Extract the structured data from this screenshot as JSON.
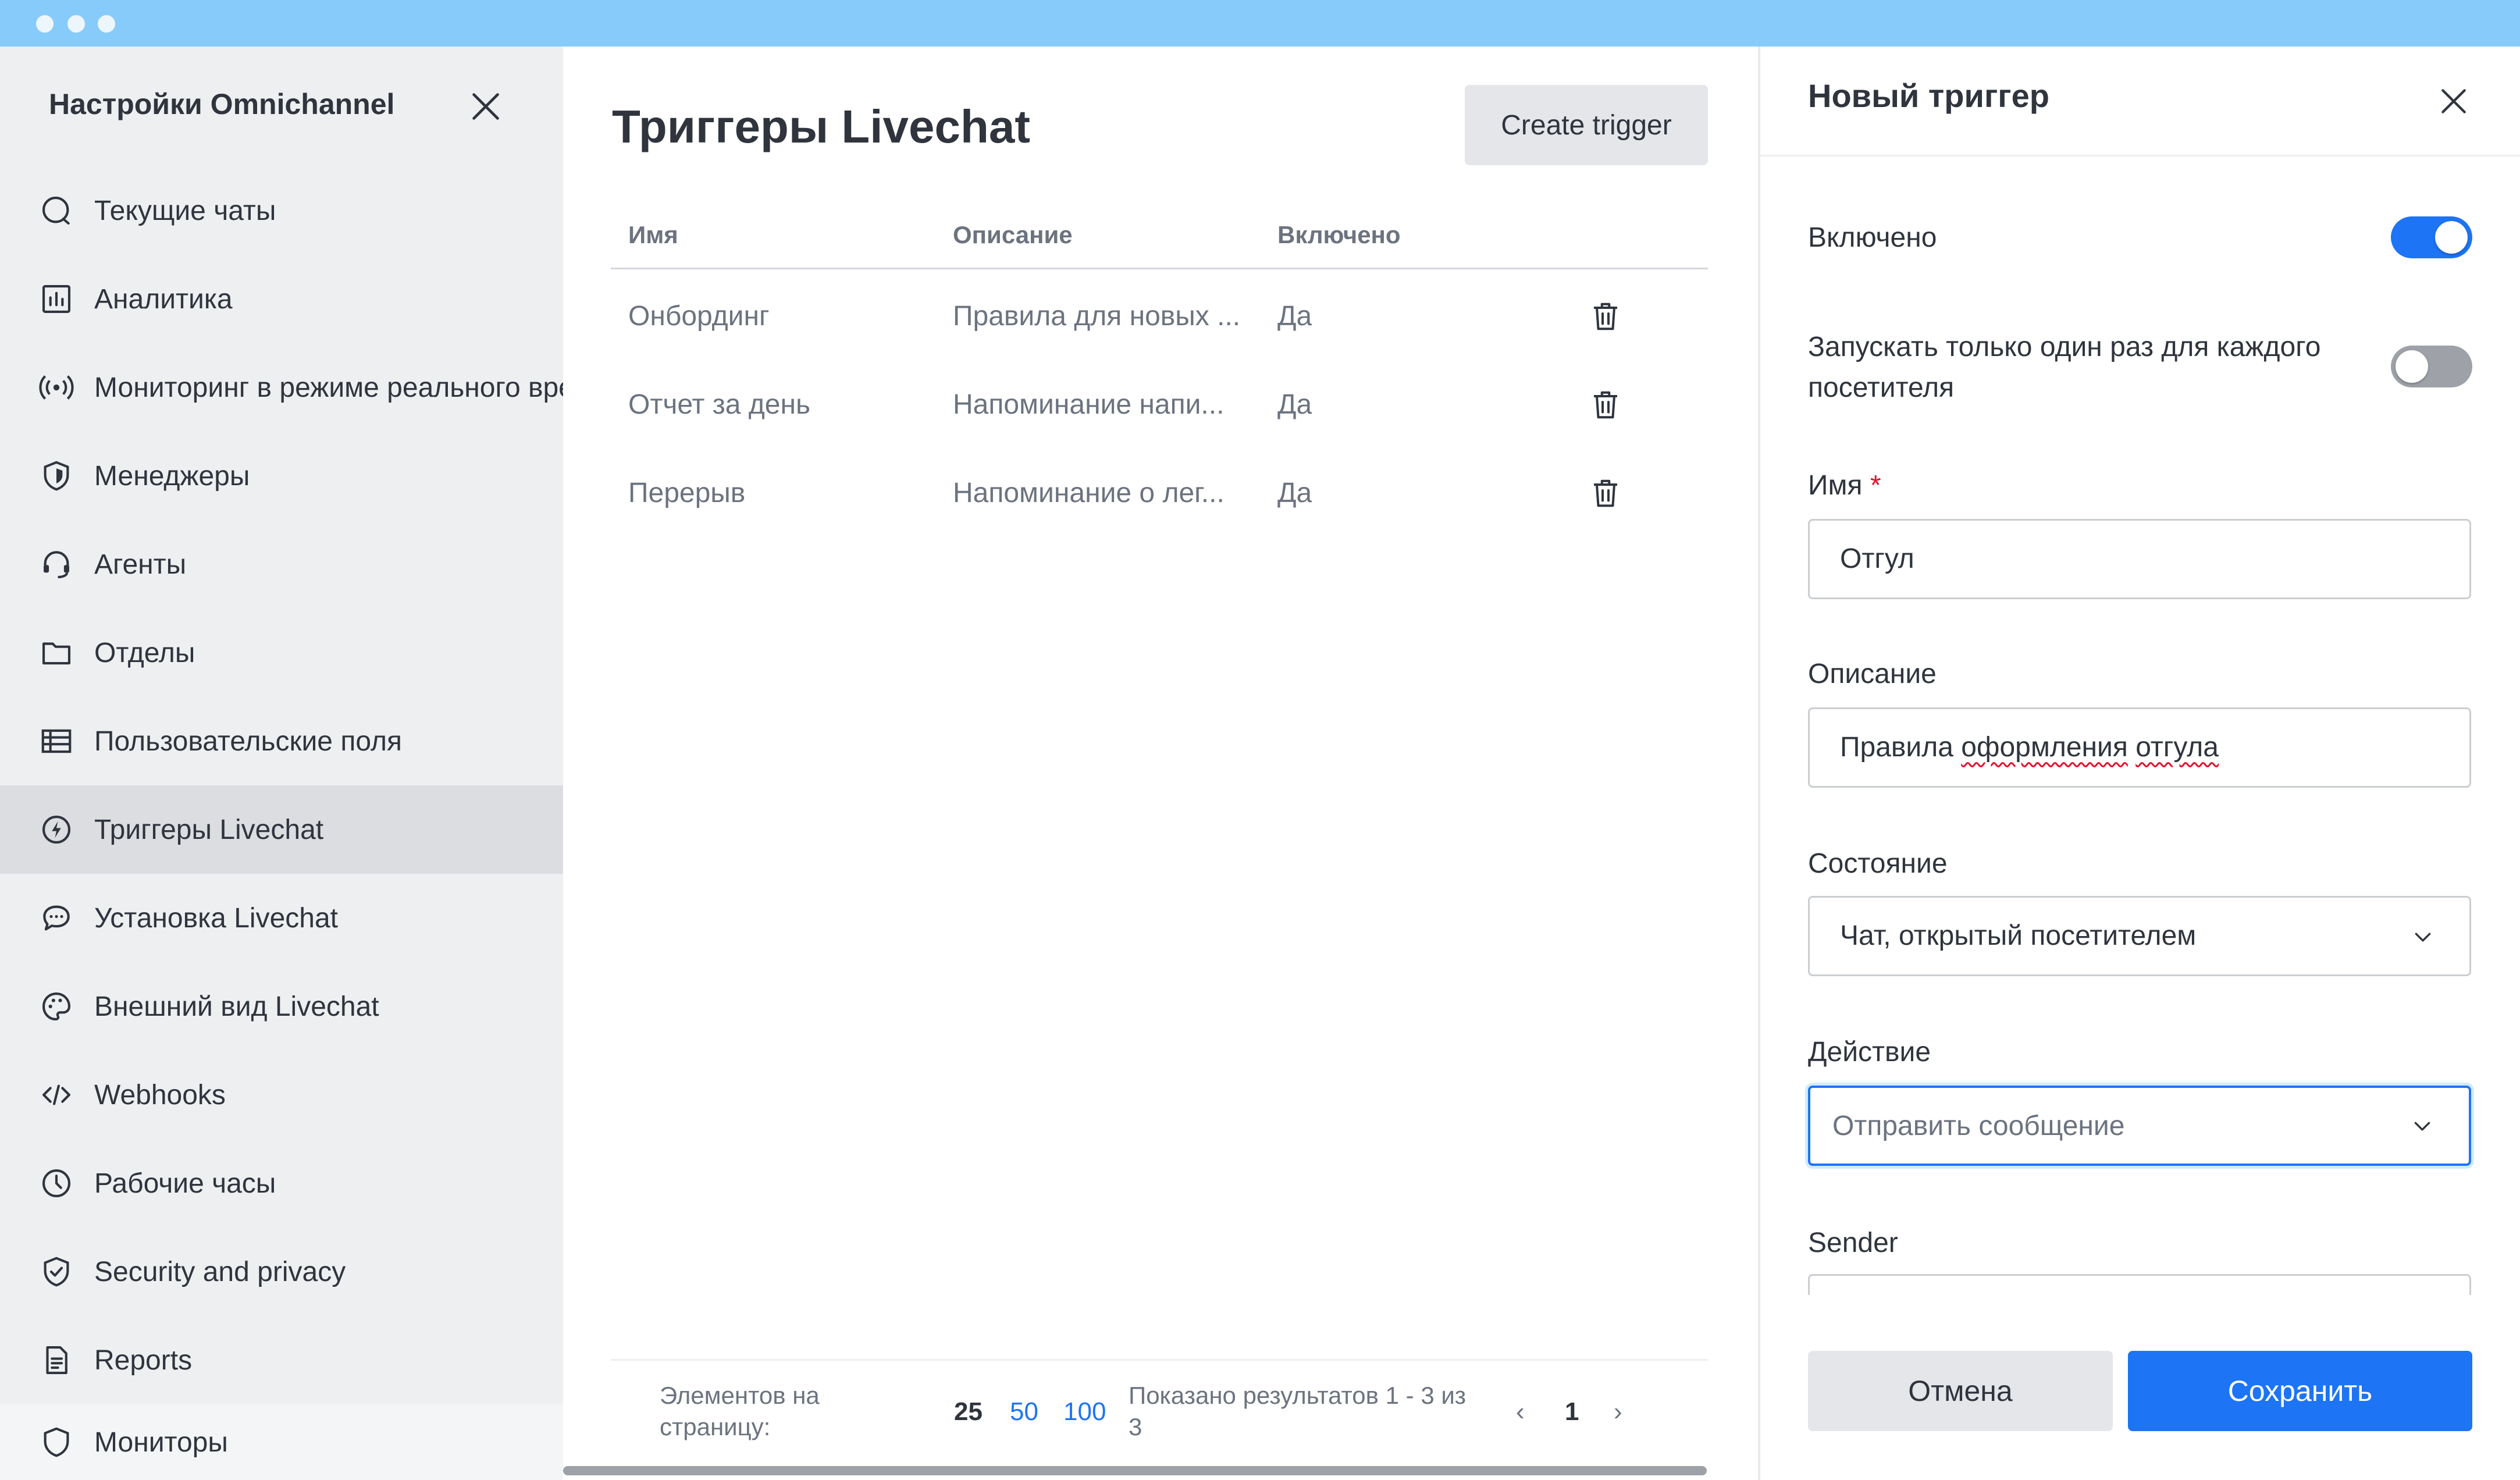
{
  "sidebar": {
    "title": "Настройки Omnichannel",
    "items": [
      {
        "label": "Текущие чаты",
        "icon": "chat-bubble-icon"
      },
      {
        "label": "Аналитика",
        "icon": "bar-chart-icon"
      },
      {
        "label": "Мониторинг в режиме реального времени",
        "icon": "broadcast-icon"
      },
      {
        "label": "Менеджеры",
        "icon": "shield-icon"
      },
      {
        "label": "Агенты",
        "icon": "headset-icon"
      },
      {
        "label": "Отделы",
        "icon": "folder-icon"
      },
      {
        "label": "Пользовательские поля",
        "icon": "table-icon"
      },
      {
        "label": "Триггеры Livechat",
        "icon": "lightning-icon"
      },
      {
        "label": "Установка Livechat",
        "icon": "speech-bubble-icon"
      },
      {
        "label": "Внешний вид Livechat",
        "icon": "palette-icon"
      },
      {
        "label": "Webhooks",
        "icon": "code-icon"
      },
      {
        "label": "Рабочие часы",
        "icon": "clock-icon"
      },
      {
        "label": "Security and privacy",
        "icon": "shield-check-icon"
      },
      {
        "label": "Reports",
        "icon": "document-icon"
      },
      {
        "label": "Мониторы",
        "icon": "shield-outline-icon"
      }
    ],
    "active_index": 7
  },
  "main": {
    "title": "Триггеры Livechat",
    "create_button": "Create trigger",
    "columns": [
      "Имя",
      "Описание",
      "Включено"
    ],
    "rows": [
      {
        "name": "Онбординг",
        "description": "Правила для новых ...",
        "enabled": "Да"
      },
      {
        "name": "Отчет за день",
        "description": "Напоминание напи...",
        "enabled": "Да"
      },
      {
        "name": "Перерыв",
        "description": "Напоминание о лег...",
        "enabled": "Да"
      }
    ],
    "pagination": {
      "per_page_label_1": "Элементов на",
      "per_page_label_2": "страницу:",
      "sizes": [
        "25",
        "50",
        "100"
      ],
      "shown_1": "Показано результатов 1 - 3 из",
      "shown_2": "3",
      "prev": "‹",
      "current_page": "1",
      "next": "›"
    }
  },
  "panel": {
    "title": "Новый триггер",
    "enabled_label": "Включено",
    "enabled_value": true,
    "run_once_label_1": "Запускать только один раз для каждого",
    "run_once_label_2": "посетителя",
    "run_once_value": false,
    "name_label": "Имя",
    "required_mark": "*",
    "name_value": "Отгул",
    "description_label": "Описание",
    "description_value_1": "Правила",
    "description_value_2": "оформления",
    "description_value_3": "отгула",
    "condition_label": "Состояние",
    "condition_value": "Чат, открытый посетителем",
    "action_label": "Действие",
    "action_value": "Отправить сообщение",
    "sender_label": "Sender",
    "cancel_button": "Отмена",
    "save_button": "Сохранить"
  },
  "colors": {
    "accent": "#1d74f5",
    "titlebar": "#87cbfb",
    "sidebar_bg": "#eeeff1",
    "active_item": "#dcdde1"
  }
}
